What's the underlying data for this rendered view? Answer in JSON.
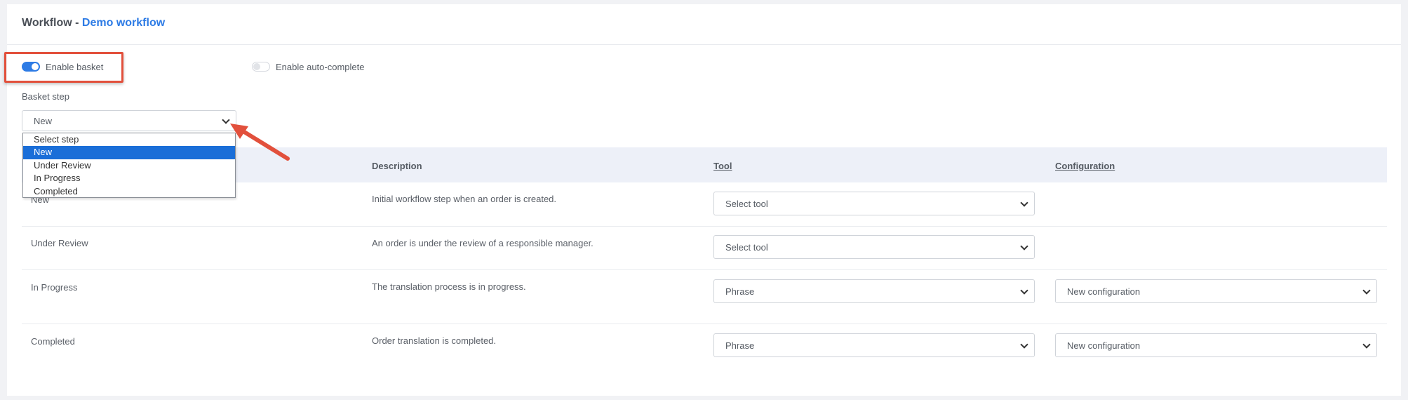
{
  "header": {
    "title_prefix": "Workflow - ",
    "title_workflow_name": "Demo workflow"
  },
  "toggles": {
    "enable_basket": {
      "label": "Enable basket",
      "on": true
    },
    "enable_auto_complete": {
      "label": "Enable auto-complete",
      "on": false
    }
  },
  "basket_step": {
    "label": "Basket step",
    "value": "New",
    "options": [
      "Select step",
      "New",
      "Under Review",
      "In Progress",
      "Completed"
    ],
    "selected_index": 1
  },
  "table": {
    "columns": {
      "description": "Description",
      "tool": "Tool",
      "configuration": "Configuration"
    },
    "rows": [
      {
        "step": "New",
        "description": "Initial workflow step when an order is created.",
        "tool": "Select tool",
        "configuration": ""
      },
      {
        "step": "Under Review",
        "description": "An order is under the review of a responsible manager.",
        "tool": "Select tool",
        "configuration": ""
      },
      {
        "step": "In Progress",
        "description": "The translation process is in progress.",
        "tool": "Phrase",
        "configuration": "New configuration"
      },
      {
        "step": "Completed",
        "description": "Order translation is completed.",
        "tool": "Phrase",
        "configuration": "New configuration"
      }
    ]
  },
  "colors": {
    "accent": "#2d7be5",
    "highlight": "#e2503c",
    "selected_option": "#1a6ed8"
  }
}
